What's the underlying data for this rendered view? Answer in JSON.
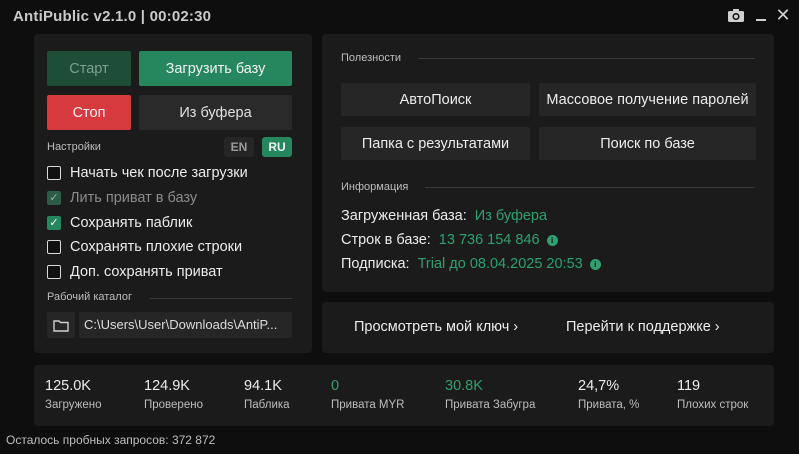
{
  "window": {
    "title": "AntiPublic v2.1.0 | 00:02:30"
  },
  "titlebar_icons": [
    "camera-icon",
    "minimize-icon",
    "close-icon"
  ],
  "controls": {
    "start_label": "Старт",
    "load_label": "Загрузить базу",
    "stop_label": "Стоп",
    "clipboard_label": "Из буфера"
  },
  "settings": {
    "label": "Настройки",
    "lang_en": "EN",
    "lang_ru": "RU",
    "options": [
      {
        "label": "Начать чек после загрузки",
        "checked": false,
        "disabled": false
      },
      {
        "label": "Лить приват в базу",
        "checked": true,
        "disabled": true
      },
      {
        "label": "Сохранять паблик",
        "checked": true,
        "disabled": false
      },
      {
        "label": "Сохранять плохие строки",
        "checked": false,
        "disabled": false
      },
      {
        "label": "Доп. сохранять приват",
        "checked": false,
        "disabled": false
      }
    ]
  },
  "catalog": {
    "label": "Рабочий каталог",
    "path": "C:\\Users\\User\\Downloads\\AntiP..."
  },
  "utilities": {
    "label": "Полезности",
    "buttons": [
      "АвтоПоиск",
      "Массовое получение паролей",
      "Папка с результатами",
      "Поиск по базе"
    ]
  },
  "information": {
    "label": "Информация",
    "loaded_base_key": "Загруженная база:",
    "loaded_base_val": "Из буфера",
    "lines_key": "Строк в базе:",
    "lines_val": "13 736 154 846",
    "subscription_key": "Подписка:",
    "subscription_val": "Trial до 08.04.2025 20:53"
  },
  "links": {
    "view_key": "Просмотреть мой ключ ›",
    "support": "Перейти к поддержке ›"
  },
  "stats": [
    {
      "value": "125.0K",
      "label": "Загружено",
      "green": false
    },
    {
      "value": "124.9K",
      "label": "Проверено",
      "green": false
    },
    {
      "value": "94.1K",
      "label": "Паблика",
      "green": false
    },
    {
      "value": "0",
      "label": "Привата MYR",
      "green": true
    },
    {
      "value": "30.8K",
      "label": "Привата Забугра",
      "green": true
    },
    {
      "value": "24,7%",
      "label": "Привата, %",
      "green": false
    },
    {
      "value": "119",
      "label": "Плохих строк",
      "green": false
    }
  ],
  "footer": {
    "remaining": "Осталось пробных запросов: 372 872"
  },
  "colors": {
    "accent": "#26875e",
    "danger": "#d63a3e",
    "info_green": "#2fa06f",
    "panel": "#1b1b1b",
    "background": "#0e0e0e"
  }
}
